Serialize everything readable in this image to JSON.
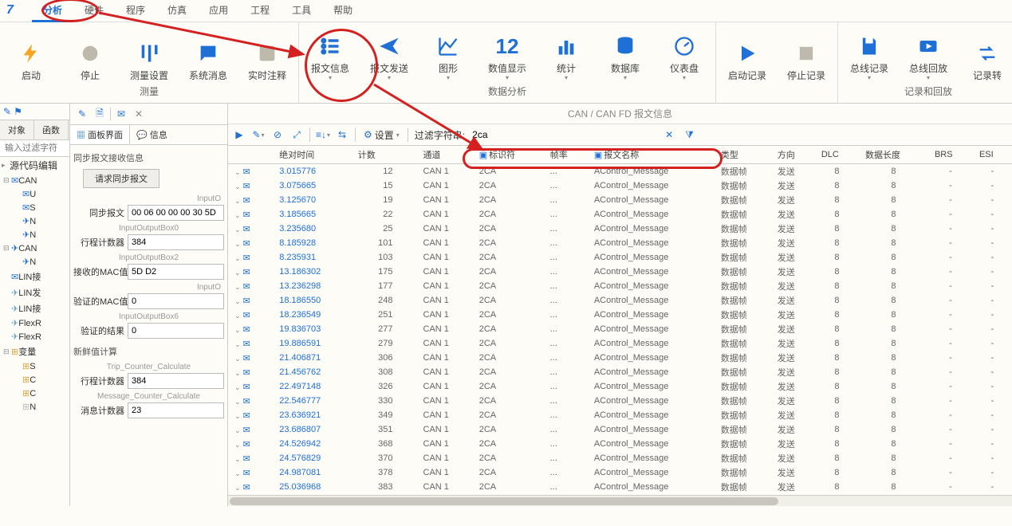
{
  "menubar": {
    "items": [
      "分析",
      "硬件",
      "程序",
      "仿真",
      "应用",
      "工程",
      "工具",
      "帮助"
    ],
    "active_index": 0
  },
  "toolbar": {
    "groups": [
      {
        "label": "测量",
        "buttons": [
          {
            "name": "start",
            "label": "启动",
            "icon": "bolt",
            "color": "#f6a623"
          },
          {
            "name": "stop",
            "label": "停止",
            "icon": "circle",
            "color": "#bdbaad"
          },
          {
            "name": "measure-config",
            "label": "测量设置",
            "icon": "sliders",
            "color": "#1e6fd6"
          },
          {
            "name": "sys-msg",
            "label": "系统消息",
            "icon": "chat",
            "color": "#1e6fd6"
          },
          {
            "name": "realtime-annot",
            "label": "实时注释",
            "icon": "note",
            "color": "#bdbaad"
          }
        ]
      },
      {
        "label": "数据分析",
        "buttons": [
          {
            "name": "msg-info",
            "label": "报文信息",
            "icon": "list",
            "color": "#1e6fd6",
            "dropdown": true
          },
          {
            "name": "msg-send",
            "label": "报文发送",
            "icon": "send",
            "color": "#1e6fd6",
            "dropdown": true
          },
          {
            "name": "graphics",
            "label": "图形",
            "icon": "chart",
            "color": "#1e6fd6",
            "dropdown": true
          },
          {
            "name": "numeric",
            "label": "数值显示",
            "icon": "12",
            "color": "#1e6fd6",
            "dropdown": true
          },
          {
            "name": "stats",
            "label": "统计",
            "icon": "bars",
            "color": "#1e6fd6",
            "dropdown": true
          },
          {
            "name": "database",
            "label": "数据库",
            "icon": "db",
            "color": "#1e6fd6",
            "dropdown": true
          },
          {
            "name": "dashboard",
            "label": "仪表盘",
            "icon": "gauge",
            "color": "#1e6fd6",
            "dropdown": true
          }
        ]
      },
      {
        "label": "",
        "buttons": [
          {
            "name": "start-record",
            "label": "启动记录",
            "icon": "play",
            "color": "#1e6fd6"
          },
          {
            "name": "stop-record",
            "label": "停止记录",
            "icon": "stop",
            "color": "#bdbaad"
          }
        ]
      },
      {
        "label": "记录和回放",
        "buttons": [
          {
            "name": "bus-record",
            "label": "总线记录",
            "icon": "save",
            "color": "#1e6fd6",
            "dropdown": true
          },
          {
            "name": "bus-replay",
            "label": "总线回放",
            "icon": "replay",
            "color": "#1e6fd6",
            "dropdown": true
          },
          {
            "name": "record-convert",
            "label": "记录转",
            "icon": "convert",
            "color": "#1e6fd6",
            "partial": true
          }
        ]
      }
    ]
  },
  "left": {
    "tabs": [
      "对象",
      "函数"
    ],
    "search_placeholder": "输入过滤字符",
    "row_src": "源代码编辑",
    "tree": [
      {
        "label": "CAN",
        "icon": "env",
        "children": [
          {
            "label": "U",
            "icon": "env"
          },
          {
            "label": "S",
            "icon": "env"
          },
          {
            "label": "N",
            "icon": "send"
          },
          {
            "label": "N",
            "icon": "send"
          }
        ]
      },
      {
        "label": "CAN",
        "icon": "send",
        "children": [
          {
            "label": "N",
            "icon": "send"
          }
        ]
      },
      {
        "label": "LIN接",
        "icon": "env"
      },
      {
        "label": "LIN发",
        "icon": "send-gray"
      },
      {
        "label": "LIN接",
        "icon": "send-gray"
      },
      {
        "label": "FlexR",
        "icon": "send-gray"
      },
      {
        "label": "FlexR",
        "icon": "send-gray"
      },
      {
        "label": "变量",
        "icon": "tree",
        "children": [
          {
            "label": "S",
            "icon": "tree"
          },
          {
            "label": "C",
            "icon": "tree"
          },
          {
            "label": "C",
            "icon": "tree"
          },
          {
            "label": "N",
            "icon": "tree-gray"
          }
        ]
      }
    ]
  },
  "mid": {
    "tabs": [
      "面板界面",
      "信息"
    ],
    "active_tab": 0,
    "sync_title": "同步报文接收信息",
    "sync_btn": "请求同步报文",
    "sub_inputo_r": "InputO",
    "field_sync_msg_label": "同步报文",
    "field_sync_msg_value": "00 06 00 00 00 30 5D",
    "sub_io0": "InputOutputBox0",
    "field_trip_label": "行程计数器",
    "field_trip_value": "384",
    "sub_io2": "InputOutputBox2",
    "field_rx_mac_label": "接收的MAC值",
    "field_rx_mac_value": "5D D2",
    "sub_inputo_r2": "InputO",
    "field_ver_mac_label": "验证的MAC值",
    "field_ver_mac_value": "0",
    "sub_io6": "InputOutputBox6",
    "field_ver_res_label": "验证的结果",
    "field_ver_res_value": "0",
    "fresh_title": "新鲜值计算",
    "sub_trip_calc": "Trip_Counter_Calculate",
    "field_trip2_label": "行程计数器",
    "field_trip2_value": "384",
    "sub_msg_calc": "Message_Counter_Calculate",
    "field_msg_cnt_label": "消息计数器",
    "field_msg_cnt_value": "23"
  },
  "right": {
    "title": "CAN / CAN FD 报文信息",
    "settings_label": "设置",
    "filter_label": "过滤字符串:",
    "filter_value": "2ca",
    "columns": [
      "",
      "绝对时间",
      "计数",
      "通道",
      "标识符",
      "帧率",
      "报文名称",
      "类型",
      "方向",
      "DLC",
      "数据长度",
      "BRS",
      "ESI"
    ],
    "rows": [
      {
        "time": "3.015776",
        "count": "12",
        "chan": "CAN 1",
        "id": "2CA",
        "rate": "...",
        "name": "AControl_Message",
        "type": "数据帧",
        "dir": "发送",
        "dlc": "8",
        "len": "8",
        "brs": "-",
        "esi": "-"
      },
      {
        "time": "3.075665",
        "count": "15",
        "chan": "CAN 1",
        "id": "2CA",
        "rate": "...",
        "name": "AControl_Message",
        "type": "数据帧",
        "dir": "发送",
        "dlc": "8",
        "len": "8",
        "brs": "-",
        "esi": "-"
      },
      {
        "time": "3.125670",
        "count": "19",
        "chan": "CAN 1",
        "id": "2CA",
        "rate": "...",
        "name": "AControl_Message",
        "type": "数据帧",
        "dir": "发送",
        "dlc": "8",
        "len": "8",
        "brs": "-",
        "esi": "-"
      },
      {
        "time": "3.185665",
        "count": "22",
        "chan": "CAN 1",
        "id": "2CA",
        "rate": "...",
        "name": "AControl_Message",
        "type": "数据帧",
        "dir": "发送",
        "dlc": "8",
        "len": "8",
        "brs": "-",
        "esi": "-"
      },
      {
        "time": "3.235680",
        "count": "25",
        "chan": "CAN 1",
        "id": "2CA",
        "rate": "...",
        "name": "AControl_Message",
        "type": "数据帧",
        "dir": "发送",
        "dlc": "8",
        "len": "8",
        "brs": "-",
        "esi": "-"
      },
      {
        "time": "8.185928",
        "count": "101",
        "chan": "CAN 1",
        "id": "2CA",
        "rate": "...",
        "name": "AControl_Message",
        "type": "数据帧",
        "dir": "发送",
        "dlc": "8",
        "len": "8",
        "brs": "-",
        "esi": "-"
      },
      {
        "time": "8.235931",
        "count": "103",
        "chan": "CAN 1",
        "id": "2CA",
        "rate": "...",
        "name": "AControl_Message",
        "type": "数据帧",
        "dir": "发送",
        "dlc": "8",
        "len": "8",
        "brs": "-",
        "esi": "-"
      },
      {
        "time": "13.186302",
        "count": "175",
        "chan": "CAN 1",
        "id": "2CA",
        "rate": "...",
        "name": "AControl_Message",
        "type": "数据帧",
        "dir": "发送",
        "dlc": "8",
        "len": "8",
        "brs": "-",
        "esi": "-"
      },
      {
        "time": "13.236298",
        "count": "177",
        "chan": "CAN 1",
        "id": "2CA",
        "rate": "...",
        "name": "AControl_Message",
        "type": "数据帧",
        "dir": "发送",
        "dlc": "8",
        "len": "8",
        "brs": "-",
        "esi": "-"
      },
      {
        "time": "18.186550",
        "count": "248",
        "chan": "CAN 1",
        "id": "2CA",
        "rate": "...",
        "name": "AControl_Message",
        "type": "数据帧",
        "dir": "发送",
        "dlc": "8",
        "len": "8",
        "brs": "-",
        "esi": "-"
      },
      {
        "time": "18.236549",
        "count": "251",
        "chan": "CAN 1",
        "id": "2CA",
        "rate": "...",
        "name": "AControl_Message",
        "type": "数据帧",
        "dir": "发送",
        "dlc": "8",
        "len": "8",
        "brs": "-",
        "esi": "-"
      },
      {
        "time": "19.836703",
        "count": "277",
        "chan": "CAN 1",
        "id": "2CA",
        "rate": "...",
        "name": "AControl_Message",
        "type": "数据帧",
        "dir": "发送",
        "dlc": "8",
        "len": "8",
        "brs": "-",
        "esi": "-"
      },
      {
        "time": "19.886591",
        "count": "279",
        "chan": "CAN 1",
        "id": "2CA",
        "rate": "...",
        "name": "AControl_Message",
        "type": "数据帧",
        "dir": "发送",
        "dlc": "8",
        "len": "8",
        "brs": "-",
        "esi": "-"
      },
      {
        "time": "21.406871",
        "count": "306",
        "chan": "CAN 1",
        "id": "2CA",
        "rate": "...",
        "name": "AControl_Message",
        "type": "数据帧",
        "dir": "发送",
        "dlc": "8",
        "len": "8",
        "brs": "-",
        "esi": "-"
      },
      {
        "time": "21.456762",
        "count": "308",
        "chan": "CAN 1",
        "id": "2CA",
        "rate": "...",
        "name": "AControl_Message",
        "type": "数据帧",
        "dir": "发送",
        "dlc": "8",
        "len": "8",
        "brs": "-",
        "esi": "-"
      },
      {
        "time": "22.497148",
        "count": "326",
        "chan": "CAN 1",
        "id": "2CA",
        "rate": "...",
        "name": "AControl_Message",
        "type": "数据帧",
        "dir": "发送",
        "dlc": "8",
        "len": "8",
        "brs": "-",
        "esi": "-"
      },
      {
        "time": "22.546777",
        "count": "330",
        "chan": "CAN 1",
        "id": "2CA",
        "rate": "...",
        "name": "AControl_Message",
        "type": "数据帧",
        "dir": "发送",
        "dlc": "8",
        "len": "8",
        "brs": "-",
        "esi": "-"
      },
      {
        "time": "23.636921",
        "count": "349",
        "chan": "CAN 1",
        "id": "2CA",
        "rate": "...",
        "name": "AControl_Message",
        "type": "数据帧",
        "dir": "发送",
        "dlc": "8",
        "len": "8",
        "brs": "-",
        "esi": "-"
      },
      {
        "time": "23.686807",
        "count": "351",
        "chan": "CAN 1",
        "id": "2CA",
        "rate": "...",
        "name": "AControl_Message",
        "type": "数据帧",
        "dir": "发送",
        "dlc": "8",
        "len": "8",
        "brs": "-",
        "esi": "-"
      },
      {
        "time": "24.526942",
        "count": "368",
        "chan": "CAN 1",
        "id": "2CA",
        "rate": "...",
        "name": "AControl_Message",
        "type": "数据帧",
        "dir": "发送",
        "dlc": "8",
        "len": "8",
        "brs": "-",
        "esi": "-"
      },
      {
        "time": "24.576829",
        "count": "370",
        "chan": "CAN 1",
        "id": "2CA",
        "rate": "...",
        "name": "AControl_Message",
        "type": "数据帧",
        "dir": "发送",
        "dlc": "8",
        "len": "8",
        "brs": "-",
        "esi": "-"
      },
      {
        "time": "24.987081",
        "count": "378",
        "chan": "CAN 1",
        "id": "2CA",
        "rate": "...",
        "name": "AControl_Message",
        "type": "数据帧",
        "dir": "发送",
        "dlc": "8",
        "len": "8",
        "brs": "-",
        "esi": "-"
      },
      {
        "time": "25.036968",
        "count": "383",
        "chan": "CAN 1",
        "id": "2CA",
        "rate": "...",
        "name": "AControl_Message",
        "type": "数据帧",
        "dir": "发送",
        "dlc": "8",
        "len": "8",
        "brs": "-",
        "esi": "-"
      }
    ]
  }
}
